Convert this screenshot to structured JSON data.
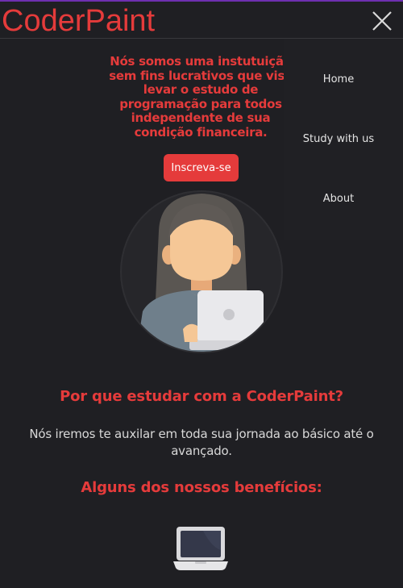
{
  "header": {
    "logo": "CoderPaint"
  },
  "nav": {
    "items": [
      "Home",
      "Study with us",
      "About"
    ]
  },
  "hero": {
    "text": "Nós somos uma instutuição sem fins lucrativos que visa levar o estudo de programação para todos independente de sua condição financeira.",
    "cta_label": "Inscreva-se"
  },
  "why": {
    "title": "Por que estudar com a CoderPaint?",
    "description": "Nós iremos te auxilar em toda sua jornada ao básico até o avançado."
  },
  "benefits": {
    "title": "Alguns dos nossos benefícios:"
  },
  "colors": {
    "accent": "#e53b3b",
    "background": "#1f1f23",
    "text": "#d8d8d8"
  }
}
